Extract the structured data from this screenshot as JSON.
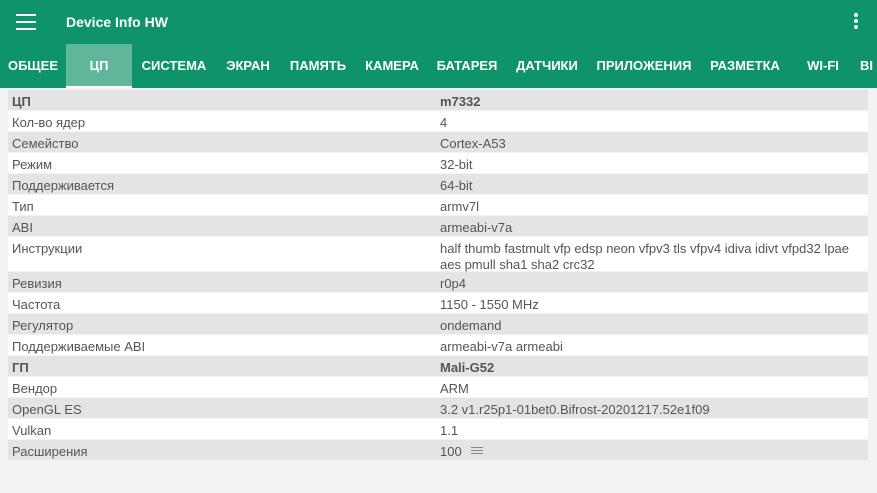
{
  "appbar": {
    "title": "Device Info HW",
    "menu_icon": "hamburger-menu-icon",
    "overflow_icon": "more-vert-icon",
    "color": "#0f936a"
  },
  "tabs": [
    {
      "label": "ОБЩЕЕ"
    },
    {
      "label": "ЦП",
      "active": true
    },
    {
      "label": "СИСТЕМА"
    },
    {
      "label": "ЭКРАН"
    },
    {
      "label": "ПАМЯТЬ"
    },
    {
      "label": "КАМЕРА"
    },
    {
      "label": "БАТАРЕЯ"
    },
    {
      "label": "ДАТЧИКИ"
    },
    {
      "label": "ПРИЛОЖЕНИЯ"
    },
    {
      "label": "РАЗМЕТКА"
    },
    {
      "label": "WI-FI"
    },
    {
      "label": "BI"
    }
  ],
  "rows": [
    {
      "key": "ЦП",
      "value": "m7332",
      "head": true
    },
    {
      "key": "Кол-во ядер",
      "value": "4"
    },
    {
      "key": "Семейство",
      "value": "Cortex-A53"
    },
    {
      "key": "Режим",
      "value": "32-bit"
    },
    {
      "key": "Поддерживается",
      "value": "64-bit"
    },
    {
      "key": "Тип",
      "value": "armv7l"
    },
    {
      "key": "ABI",
      "value": "armeabi-v7a"
    },
    {
      "key": "Инструкции",
      "value": "half thumb fastmult vfp edsp neon vfpv3 tls vfpv4 idiva idivt vfpd32 lpae aes pmull sha1 sha2 crc32"
    },
    {
      "key": "Ревизия",
      "value": "r0p4"
    },
    {
      "key": "Частота",
      "value": "1150 - 1550 MHz"
    },
    {
      "key": "Регулятор",
      "value": "ondemand"
    },
    {
      "key": "Поддерживаемые ABI",
      "value": "armeabi-v7a armeabi"
    },
    {
      "key": "ГП",
      "value": "Mali-G52",
      "head": true
    },
    {
      "key": "Вендор",
      "value": "ARM"
    },
    {
      "key": "OpenGL ES",
      "value": "3.2 v1.r25p1-01bet0.Bifrost-20201217.52e1f09"
    },
    {
      "key": "Vulkan",
      "value": "1.1"
    },
    {
      "key": "Расширения",
      "value": "100",
      "icon": "list-icon"
    }
  ]
}
